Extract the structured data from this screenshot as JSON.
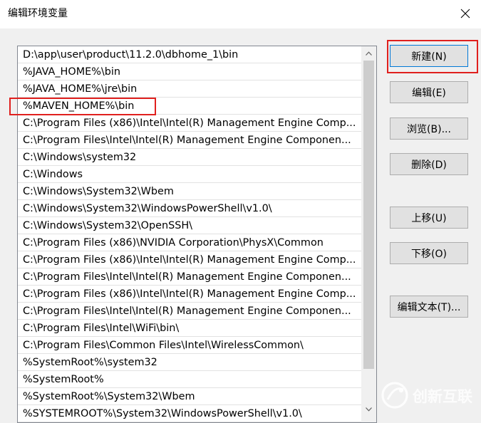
{
  "window": {
    "title": "编辑环境变量",
    "close_icon": "close-icon"
  },
  "path_list": {
    "items": [
      "D:\\app\\user\\product\\11.2.0\\dbhome_1\\bin",
      "%JAVA_HOME%\\bin",
      "%JAVA_HOME%\\jre\\bin",
      "%MAVEN_HOME%\\bin",
      "C:\\Program Files (x86)\\Intel\\Intel(R) Management Engine Comp...",
      "C:\\Program Files\\Intel\\Intel(R) Management Engine Componen...",
      "C:\\Windows\\system32",
      "C:\\Windows",
      "C:\\Windows\\System32\\Wbem",
      "C:\\Windows\\System32\\WindowsPowerShell\\v1.0\\",
      "C:\\Windows\\System32\\OpenSSH\\",
      "C:\\Program Files (x86)\\NVIDIA Corporation\\PhysX\\Common",
      "C:\\Program Files (x86)\\Intel\\Intel(R) Management Engine Comp...",
      "C:\\Program Files\\Intel\\Intel(R) Management Engine Componen...",
      "C:\\Program Files (x86)\\Intel\\Intel(R) Management Engine Comp...",
      "C:\\Program Files\\Intel\\Intel(R) Management Engine Componen...",
      "C:\\Program Files\\Intel\\WiFi\\bin\\",
      "C:\\Program Files\\Common Files\\Intel\\WirelessCommon\\",
      "%SystemRoot%\\system32",
      "%SystemRoot%",
      "%SystemRoot%\\System32\\Wbem",
      "%SYSTEMROOT%\\System32\\WindowsPowerShell\\v1.0\\"
    ],
    "scroll_up_icon": "chevron-up-icon",
    "scroll_down_icon": "chevron-down-icon"
  },
  "buttons": {
    "new": "新建(N)",
    "edit": "编辑(E)",
    "browse": "浏览(B)...",
    "delete": "删除(D)",
    "move_up": "上移(U)",
    "move_down": "下移(O)",
    "edit_text": "编辑文本(T)..."
  },
  "watermark": {
    "text": "创新互联",
    "icon": "watermark-logo-icon"
  },
  "colors": {
    "highlight_box": "#e0201e",
    "focus_border": "#0078d7",
    "watermark_brand": "#ffffff"
  }
}
